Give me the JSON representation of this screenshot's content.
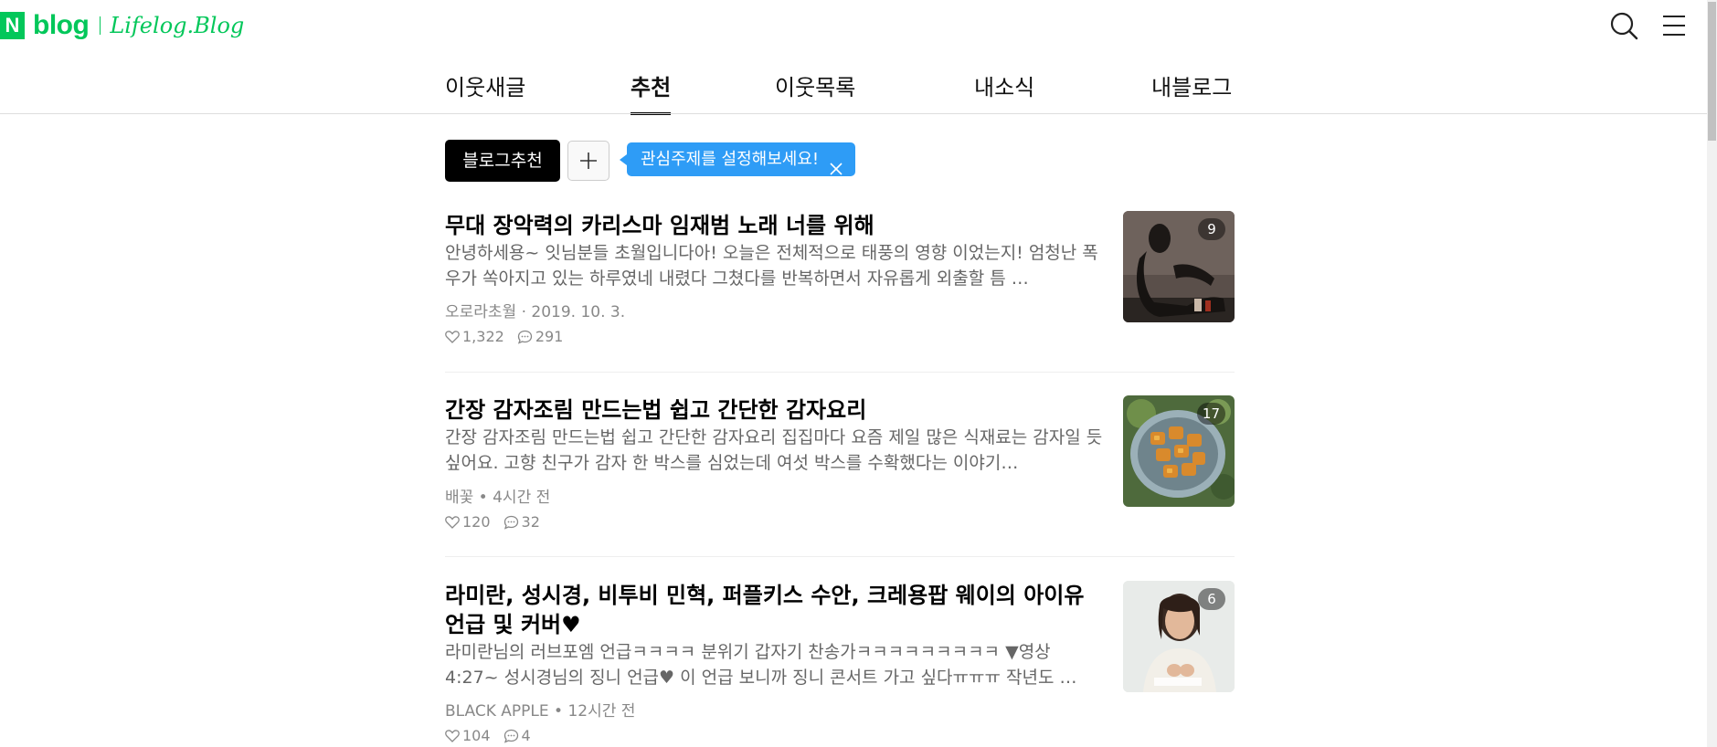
{
  "header": {
    "logo_n": "N",
    "logo_blog": "blog",
    "logo_sub": "Lifelog.Blog",
    "brand_color": "#03c75a"
  },
  "tabs": [
    {
      "label": "이웃새글",
      "active": false
    },
    {
      "label": "추천",
      "active": true
    },
    {
      "label": "이웃목록",
      "active": false
    },
    {
      "label": "내소식",
      "active": false
    },
    {
      "label": "내블로그",
      "active": false
    }
  ],
  "chips": {
    "primary_label": "블로그추천",
    "tooltip_text": "관심주제를 설정해보세요!",
    "tooltip_color": "#2e9cf6"
  },
  "posts": [
    {
      "title": "무대 장악력의 카리스마 임재범 노래 너를 위해",
      "excerpt": "안녕하세용~ 잇님분들 초월입니다아! 오늘은 전체적으로 태풍의 영향 이었는지! 엄청난 폭우가 쏙아지고 있는 하루였네 내렸다 그쳤다를 반복하면서 자유롭게 외출할 틈 …",
      "meta": "오로라초월 · 2019. 10. 3.",
      "likes": "1,322",
      "comments": "291",
      "photo_count": "9"
    },
    {
      "title": "간장 감자조림 만드는법 쉽고 간단한 감자요리",
      "excerpt": "간장 감자조림 만드는법 쉽고 간단한 감자요리 집집마다 요즘 제일 많은 식재료는 감자일 듯싶어요. 고향 친구가 감자 한 박스를 심었는데 여섯 박스를 수확했다는 이야기…",
      "meta": "배꽃 • 4시간 전",
      "likes": "120",
      "comments": "32",
      "photo_count": "17"
    },
    {
      "title": "라미란, 성시경, 비투비 민혁, 퍼플키스 수안, 크레용팝 웨이의 아이유 언급 및 커버♥",
      "excerpt": "라미란님의 러브포엠 언급ㅋㅋㅋㅋ 분위기 갑자기 찬송가ㅋㅋㅋㅋㅋㅋㅋㅋㅋ ▼영상 4:27~ 성시경님의 징니 언급♥ 이 언급 보니까 징니 콘서트 가고 싶다ㅠㅠㅠ 작년도 …",
      "meta": "BLACK APPLE • 12시간 전",
      "likes": "104",
      "comments": "4",
      "photo_count": "6"
    }
  ]
}
